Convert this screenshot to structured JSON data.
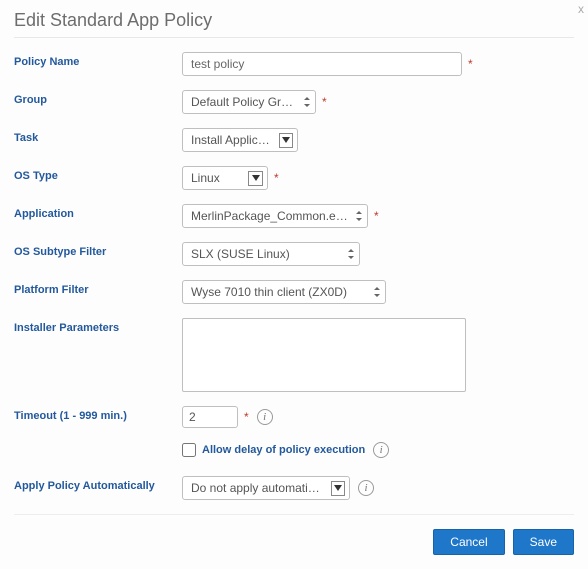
{
  "title": "Edit Standard App Policy",
  "close": "x",
  "labels": {
    "policyName": "Policy Name",
    "group": "Group",
    "task": "Task",
    "osType": "OS Type",
    "application": "Application",
    "osSubtype": "OS Subtype Filter",
    "platformFilter": "Platform Filter",
    "installerParams": "Installer Parameters",
    "timeout": "Timeout (1 - 999 min.)",
    "allowDelay": "Allow delay of policy execution",
    "applyAuto": "Apply Policy Automatically"
  },
  "values": {
    "policyName": "test policy",
    "group": "Default Policy Group",
    "task": "Install Application",
    "osType": "Linux",
    "application": "MerlinPackage_Common.exe (Loc",
    "osSubtype": "SLX (SUSE Linux)",
    "platformFilter": "Wyse 7010 thin client (ZX0D)",
    "installerParams": "",
    "timeout": "2",
    "applyAuto": "Do not apply automatically"
  },
  "buttons": {
    "cancel": "Cancel",
    "save": "Save"
  }
}
